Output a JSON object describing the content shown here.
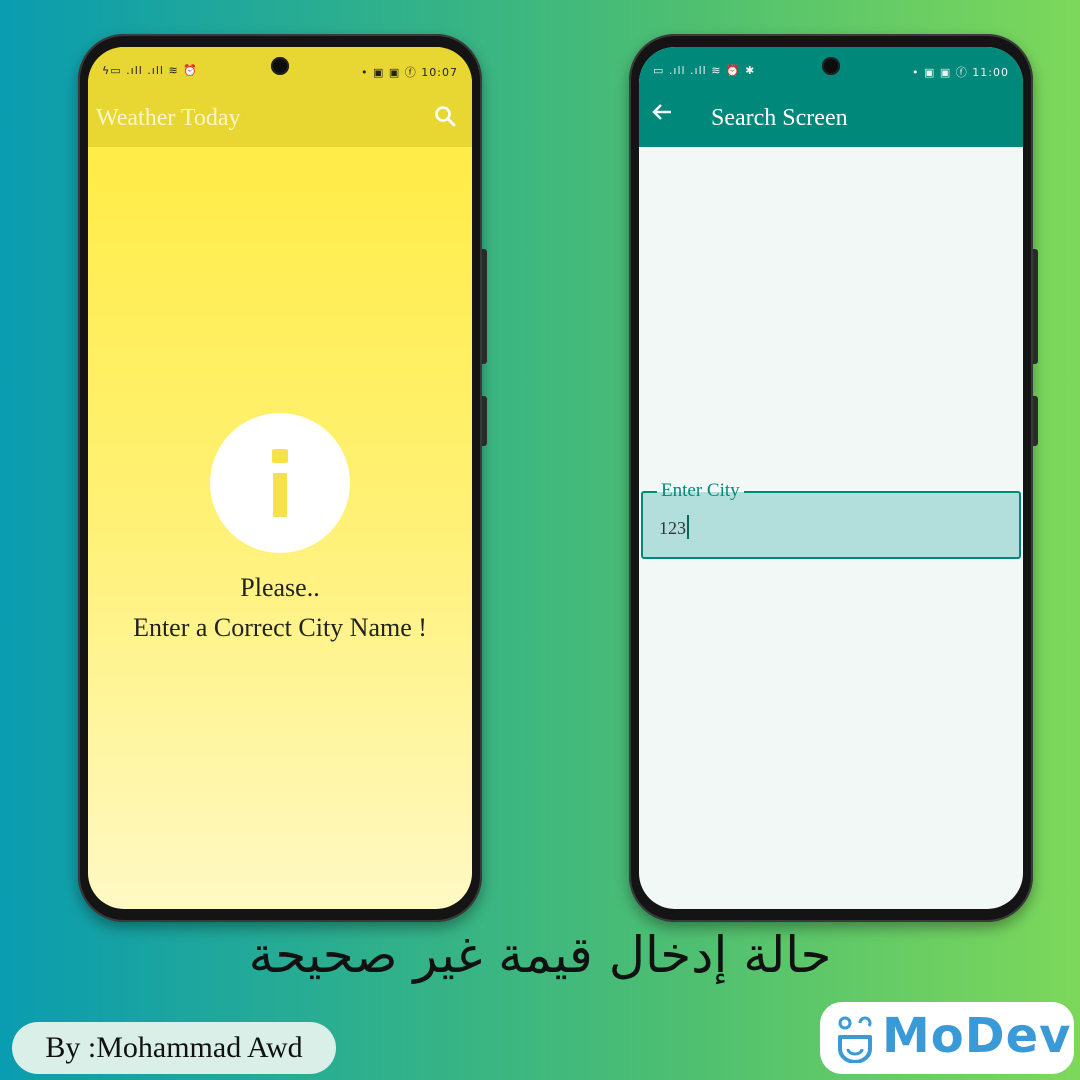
{
  "left_phone": {
    "status_left": "ϟ▭ .ıll .ıll ≋ ⏰",
    "status_right": "• ▣ ▣ ⓕ 10:07",
    "appbar_title": "Weather Today",
    "message_line1": "Please..",
    "message_line2": "Enter a Correct City Name !"
  },
  "right_phone": {
    "status_left": "▭ .ıll .ıll ≋ ⏰ ✱",
    "status_right": "• ▣ ▣ ⓕ 11:00",
    "appbar_title": "Search Screen",
    "field_label": "Enter City",
    "field_value": "123"
  },
  "caption": "حالة إدخال قيمة غير صحيحة",
  "author": "By :Mohammad Awd",
  "logo_text": "MoDev",
  "colors": {
    "weather_yellow": "#ffeb3b",
    "teal_primary": "#00897b",
    "field_fill": "#b2dfdb",
    "logo_blue": "#3a9ad8"
  },
  "icons": [
    "search-icon",
    "back-arrow-icon",
    "info-icon",
    "modev-logo-icon"
  ]
}
